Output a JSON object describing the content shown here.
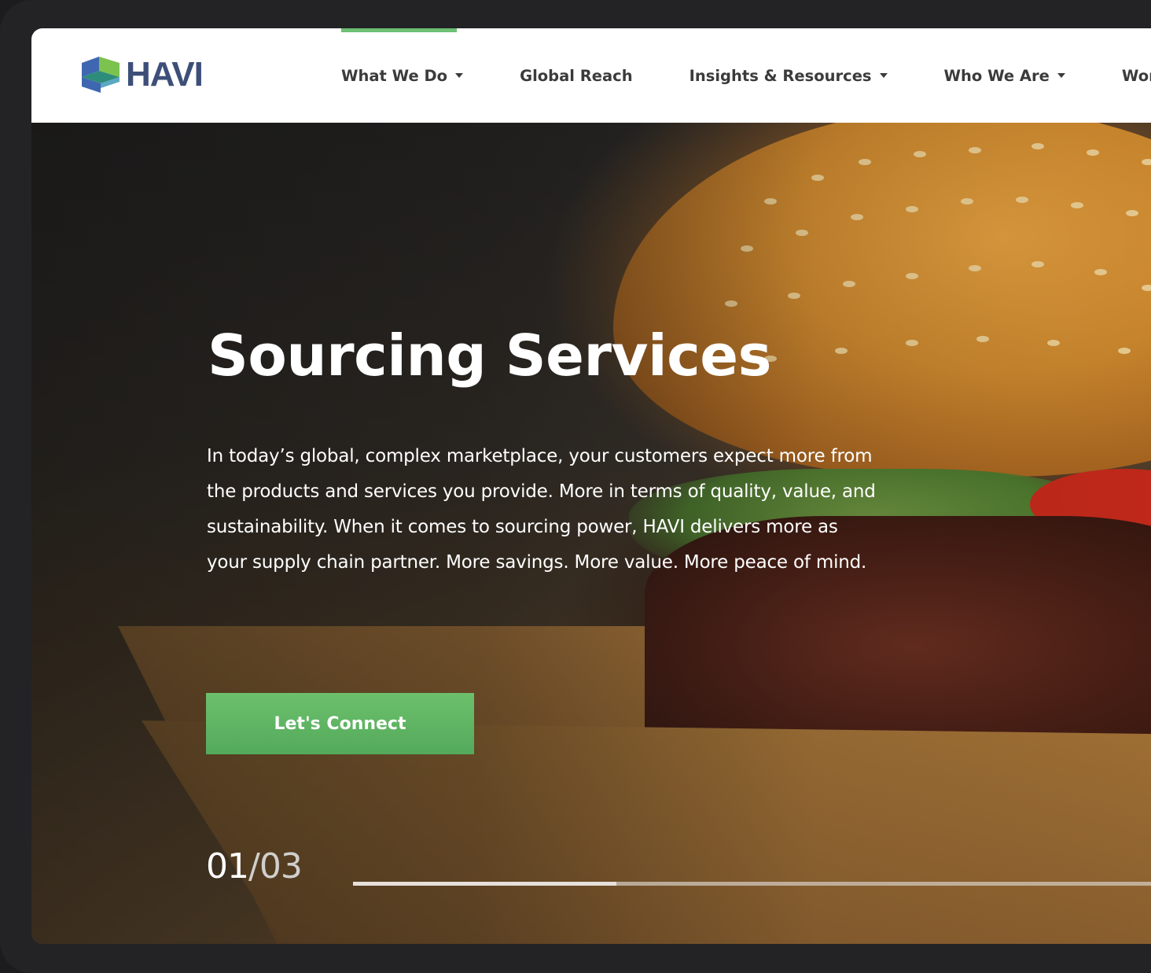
{
  "header": {
    "logo_text": "HAVI",
    "nav": [
      {
        "label": "What We Do",
        "has_dropdown": true,
        "active": true
      },
      {
        "label": "Global Reach",
        "has_dropdown": false,
        "active": false
      },
      {
        "label": "Insights & Resources",
        "has_dropdown": true,
        "active": false
      },
      {
        "label": "Who We Are",
        "has_dropdown": true,
        "active": false
      },
      {
        "label": "Workin",
        "has_dropdown": false,
        "active": false
      }
    ]
  },
  "hero": {
    "title": "Sourcing Services",
    "body": "In today’s global, complex marketplace, your customers expect more from the products and services you provide. More in terms of quality, value, and sustainability. When it comes to sourcing power, HAVI delivers more as your supply chain partner. More savings. More value. More peace of mind.",
    "cta_label": "Let's Connect",
    "slide_current": "01",
    "slide_separator": "/",
    "slide_total": "03",
    "slide_progress": 0.33,
    "background_image": "burger-in-paper-box"
  },
  "colors": {
    "accent_green": "#6dbf73",
    "cta_green": "#5cb463",
    "logo_blue": "#3d4f79",
    "nav_text": "#3b3b3b"
  },
  "icons": {
    "logo_mark": "havi-logo-icon",
    "dropdown": "caret-down-icon"
  }
}
